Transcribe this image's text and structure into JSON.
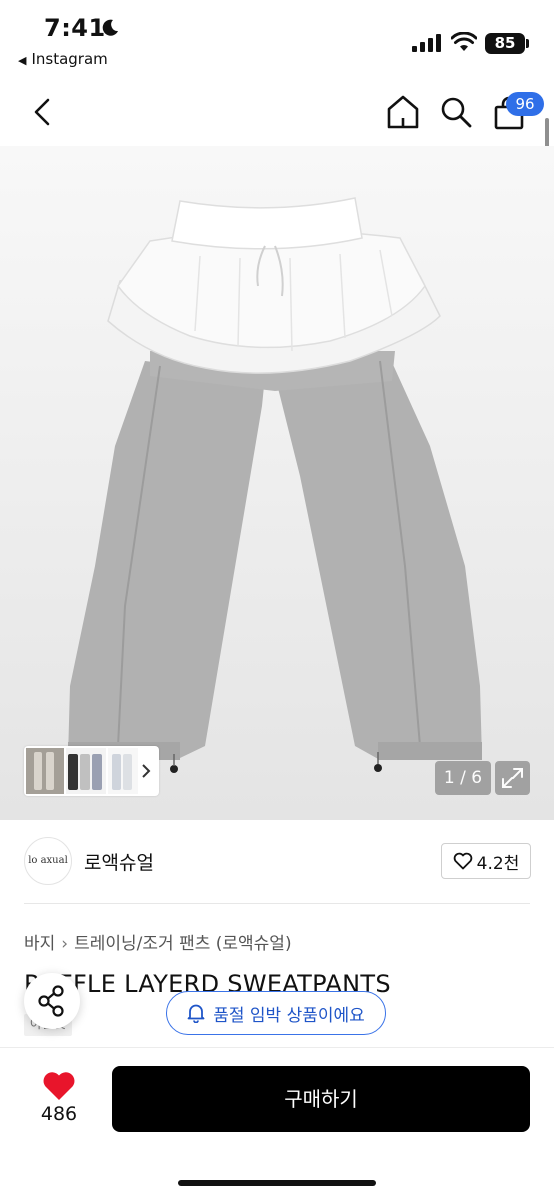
{
  "status_bar": {
    "time": "7:41",
    "back_app": "Instagram",
    "battery": "85"
  },
  "header": {
    "cart_count": "96"
  },
  "gallery": {
    "counter": "1 / 6"
  },
  "seller": {
    "logo_text": "lo axual",
    "name": "로액슈얼",
    "likes": "4.2천"
  },
  "breadcrumb": {
    "items": [
      "바지",
      "트레이닝/조거 팬츠 (로액슈얼)"
    ]
  },
  "product": {
    "title": "RUFFLE LAYERD SWEATPANTS",
    "tag": "아울렛"
  },
  "notice": {
    "label": "품절 임박 상품이에요"
  },
  "bottom": {
    "like_count": "486",
    "buy_label": "구매하기"
  },
  "colors": {
    "accent": "#2f6fe8",
    "like_red": "#e8152b",
    "buy_bg": "#000000"
  }
}
